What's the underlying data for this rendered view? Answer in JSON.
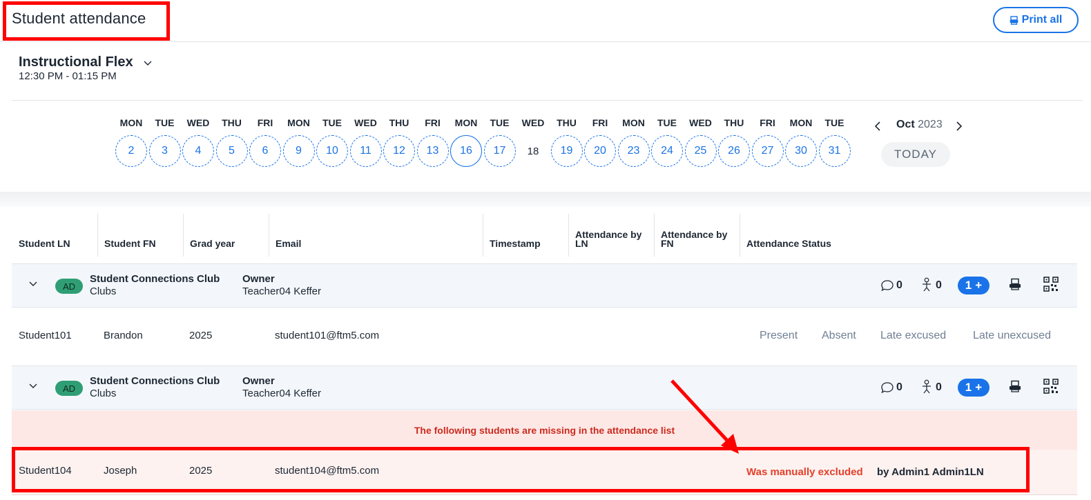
{
  "header": {
    "title": "Student attendance",
    "print_all_label": "Print all"
  },
  "period": {
    "name": "Instructional Flex",
    "time": "12:30 PM - 01:15 PM"
  },
  "calendar": {
    "days": [
      {
        "name": "MON",
        "num": "2"
      },
      {
        "name": "TUE",
        "num": "3"
      },
      {
        "name": "WED",
        "num": "4"
      },
      {
        "name": "THU",
        "num": "5"
      },
      {
        "name": "FRI",
        "num": "6"
      },
      {
        "name": "MON",
        "num": "9"
      },
      {
        "name": "TUE",
        "num": "10"
      },
      {
        "name": "WED",
        "num": "11"
      },
      {
        "name": "THU",
        "num": "12"
      },
      {
        "name": "FRI",
        "num": "13"
      },
      {
        "name": "MON",
        "num": "16",
        "state": "selected"
      },
      {
        "name": "TUE",
        "num": "17"
      },
      {
        "name": "WED",
        "num": "18",
        "state": "plain"
      },
      {
        "name": "THU",
        "num": "19"
      },
      {
        "name": "FRI",
        "num": "20"
      },
      {
        "name": "MON",
        "num": "23"
      },
      {
        "name": "TUE",
        "num": "24"
      },
      {
        "name": "WED",
        "num": "25"
      },
      {
        "name": "THU",
        "num": "26"
      },
      {
        "name": "FRI",
        "num": "27"
      },
      {
        "name": "MON",
        "num": "30"
      },
      {
        "name": "TUE",
        "num": "31"
      }
    ],
    "month": "Oct",
    "year": "2023",
    "today_label": "TODAY"
  },
  "table": {
    "columns": [
      "Student LN",
      "Student FN",
      "Grad year",
      "Email",
      "Timestamp",
      "Attendance by LN",
      "Attendance by FN",
      "Attendance Status"
    ],
    "groups": [
      {
        "badge": "AD",
        "name": "Student Connections Club",
        "category": "Clubs",
        "owner_label": "Owner",
        "owner_name": "Teacher04 Keffer",
        "comment_count": "0",
        "person_count": "0",
        "add_count": "1"
      },
      {
        "badge": "AD",
        "name": "Student Connections Club",
        "category": "Clubs",
        "owner_label": "Owner",
        "owner_name": "Teacher04 Keffer",
        "comment_count": "0",
        "person_count": "0",
        "add_count": "1"
      }
    ],
    "student_row": {
      "ln": "Student101",
      "fn": "Brandon",
      "grad_year": "2025",
      "email": "student101@ftm5.com",
      "options": [
        "Present",
        "Absent",
        "Late excused",
        "Late unexcused"
      ]
    },
    "missing_banner": "The following students are missing in the attendance list",
    "missing_row": {
      "ln": "Student104",
      "fn": "Joseph",
      "grad_year": "2025",
      "email": "student104@ftm5.com",
      "status": "Was manually excluded",
      "by": "by Admin1 Admin1LN"
    }
  },
  "colors": {
    "accent": "#1a73e8",
    "badge": "#2f9e74",
    "alert": "#e3402a",
    "annotation": "#ff0000"
  }
}
